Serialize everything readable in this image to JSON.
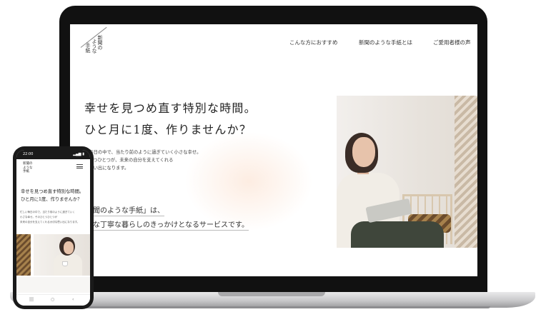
{
  "site": {
    "logo_lines": [
      "新聞の",
      "ような",
      "手紙"
    ],
    "nav": [
      "こんな方におすすめ",
      "新聞のような手紙とは",
      "ご愛用者様の声"
    ]
  },
  "hero": {
    "title_line1": "幸せを見つめ直す特別な時間。",
    "title_line2": "ひと月に1度、作りませんか？",
    "desc_line1": "い毎日の中で、当たり前のように過ぎていく小さな幸せ。",
    "desc_line2": "ひとつひとつが、未来の自分を支えてくれる",
    "desc_line3": "な思い出になります。",
    "tagline_line1": "新聞のような手紙」は、",
    "tagline_line2": "んな丁寧な暮らしのきっかけとなるサービスです。"
  },
  "phone": {
    "time": "22:00",
    "logo_lines": [
      "新聞の",
      "ような",
      "手紙"
    ],
    "title_line1": "幸せを見つめ直す特別な時間。",
    "title_line2": "ひと月に1度、作りませんか？",
    "desc_line1": "忙しい毎日の中で、当たり前のように過ぎていく",
    "desc_line2": "小さな幸せ。そのひとつひとつが",
    "desc_line3": "未来の自分を支えてくれる大切な思い出になります。",
    "nav_icons": [
      "menu-icon",
      "home-icon",
      "back-icon"
    ]
  },
  "colors": {
    "laptop_frame": "#111111",
    "text": "#2b2b2b",
    "accent_glow": "#fad6be"
  }
}
